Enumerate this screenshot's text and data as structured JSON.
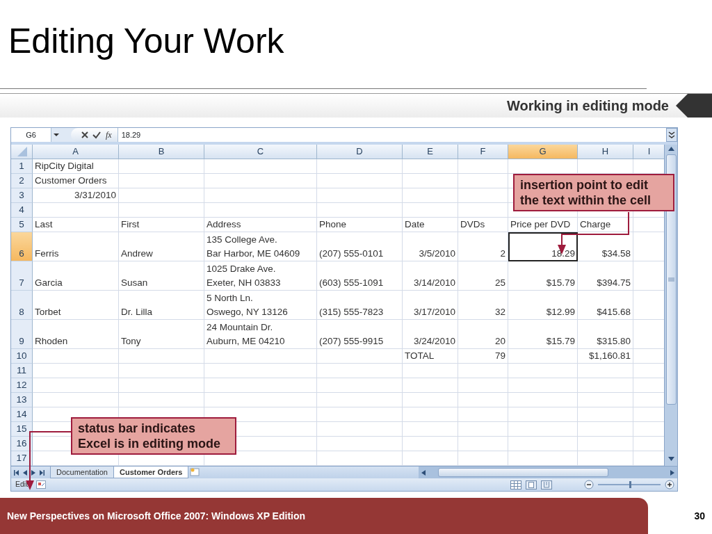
{
  "slide": {
    "title": "Editing Your Work",
    "banner": "Working in editing mode"
  },
  "spreadsheet": {
    "name_box": "G6",
    "function_label": "fx",
    "formula": "18.29",
    "columns": [
      {
        "label": "A",
        "selected": false
      },
      {
        "label": "B",
        "selected": false
      },
      {
        "label": "C",
        "selected": false
      },
      {
        "label": "D",
        "selected": false
      },
      {
        "label": "E",
        "selected": false
      },
      {
        "label": "F",
        "selected": false
      },
      {
        "label": "G",
        "selected": true
      },
      {
        "label": "H",
        "selected": false
      },
      {
        "label": "I",
        "selected": false
      }
    ],
    "rows": [
      {
        "number": "1",
        "selected": false,
        "cells": [
          {
            "text": "RipCity Digital",
            "kind": "text"
          }
        ]
      },
      {
        "number": "2",
        "selected": false,
        "cells": [
          {
            "text": "Customer Orders",
            "kind": "text"
          }
        ]
      },
      {
        "number": "3",
        "selected": false,
        "cells": [
          {
            "text": "3/31/2010",
            "kind": "number"
          }
        ]
      },
      {
        "number": "4",
        "selected": false
      },
      {
        "number": "5",
        "selected": false,
        "cells": [
          {
            "text": "Last",
            "kind": "text"
          },
          {
            "text": "First",
            "kind": "text"
          },
          {
            "text": "Address",
            "kind": "text"
          },
          {
            "text": "Phone",
            "kind": "text"
          },
          {
            "text": "Date",
            "kind": "text"
          },
          {
            "text": "DVDs",
            "kind": "text"
          },
          {
            "text": "Price per DVD",
            "kind": "text"
          },
          {
            "text": "Charge",
            "kind": "text"
          }
        ]
      },
      {
        "number": "6",
        "selected": true,
        "cells": [
          {
            "text": "Ferris",
            "kind": "text"
          },
          {
            "text": "Andrew",
            "kind": "text"
          },
          {
            "text": "135 College Ave.\nBar Harbor, ME 04609",
            "kind": "text"
          },
          {
            "text": "(207) 555-0101",
            "kind": "text"
          },
          {
            "text": "3/5/2010",
            "kind": "number"
          },
          {
            "text": "2",
            "kind": "number"
          },
          {
            "text": "18.29",
            "kind": "number"
          },
          {
            "text": "$34.58",
            "kind": "number"
          }
        ]
      },
      {
        "number": "7",
        "selected": false,
        "cells": [
          {
            "text": "Garcia",
            "kind": "text"
          },
          {
            "text": "Susan",
            "kind": "text"
          },
          {
            "text": "1025 Drake Ave.\nExeter, NH 03833",
            "kind": "text"
          },
          {
            "text": "(603) 555-1091",
            "kind": "text"
          },
          {
            "text": "3/14/2010",
            "kind": "number"
          },
          {
            "text": "25",
            "kind": "number"
          },
          {
            "text": "$15.79",
            "kind": "number"
          },
          {
            "text": "$394.75",
            "kind": "number"
          }
        ]
      },
      {
        "number": "8",
        "selected": false,
        "cells": [
          {
            "text": "Torbet",
            "kind": "text"
          },
          {
            "text": "Dr. Lilla",
            "kind": "text"
          },
          {
            "text": "5 North Ln.\nOswego, NY 13126",
            "kind": "text"
          },
          {
            "text": "(315) 555-7823",
            "kind": "text"
          },
          {
            "text": "3/17/2010",
            "kind": "number"
          },
          {
            "text": "32",
            "kind": "number"
          },
          {
            "text": "$12.99",
            "kind": "number"
          },
          {
            "text": "$415.68",
            "kind": "number"
          }
        ]
      },
      {
        "number": "9",
        "selected": false,
        "cells": [
          {
            "text": "Rhoden",
            "kind": "text"
          },
          {
            "text": "Tony",
            "kind": "text"
          },
          {
            "text": "24 Mountain Dr.\nAuburn, ME 04210",
            "kind": "text"
          },
          {
            "text": "(207) 555-9915",
            "kind": "text"
          },
          {
            "text": "3/24/2010",
            "kind": "number"
          },
          {
            "text": "20",
            "kind": "number"
          },
          {
            "text": "$15.79",
            "kind": "number"
          },
          {
            "text": "$315.80",
            "kind": "number"
          }
        ]
      },
      {
        "number": "10",
        "selected": false,
        "cells": [
          null,
          null,
          null,
          null,
          {
            "text": "TOTAL",
            "kind": "text"
          },
          {
            "text": "79",
            "kind": "number"
          },
          null,
          {
            "text": "$1,160.81",
            "kind": "number"
          }
        ]
      },
      {
        "number": "11",
        "selected": false
      },
      {
        "number": "12",
        "selected": false
      },
      {
        "number": "13",
        "selected": false
      },
      {
        "number": "14",
        "selected": false
      },
      {
        "number": "15",
        "selected": false
      },
      {
        "number": "16",
        "selected": false
      },
      {
        "number": "17",
        "selected": false
      }
    ],
    "sheet_tabs": [
      {
        "label": "Documentation",
        "selected": false
      },
      {
        "label": "Customer Orders",
        "selected": true
      }
    ],
    "status_bar": {
      "mode": "Edit",
      "zoom_slider": {
        "level": 0.5
      }
    }
  },
  "callouts": [
    {
      "lines": [
        "insertion point to edit",
        "the text within the cell"
      ]
    },
    {
      "lines": [
        "status bar indicates",
        "Excel is in editing mode"
      ]
    }
  ],
  "footer": {
    "course": "New Perspectives on Microsoft Office 2007: Windows XP Edition",
    "page": "30"
  }
}
